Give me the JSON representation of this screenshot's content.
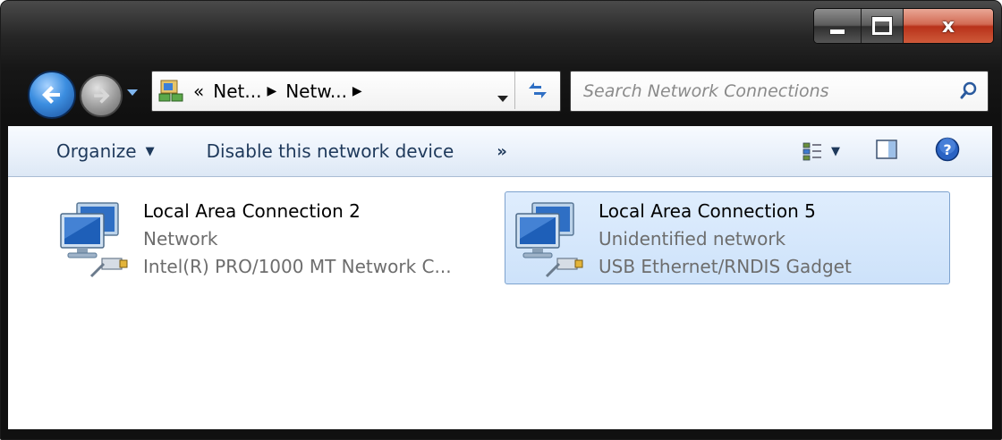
{
  "window": {
    "caption": {
      "close_glyph": "x"
    }
  },
  "navigation": {
    "address_breadcrumbs": [
      "«",
      "Net...",
      "Netw..."
    ],
    "search_placeholder": "Search Network Connections"
  },
  "command_bar": {
    "organize_label": "Organize",
    "disable_label": "Disable this network device",
    "more_label": "»"
  },
  "connections": [
    {
      "name": "Local Area Connection 2",
      "status": "Network",
      "adapter": "Intel(R) PRO/1000 MT Network C...",
      "selected": false
    },
    {
      "name": "Local Area Connection 5",
      "status": "Unidentified network",
      "adapter": "USB Ethernet/RNDIS Gadget",
      "selected": true
    }
  ],
  "colors": {
    "selection_fill": "#cde2fa",
    "selection_border": "#7da2ce",
    "command_text": "#1e395b",
    "close_red": "#c13b20"
  },
  "icons": {
    "back": "back-arrow-icon",
    "forward": "forward-arrow-icon",
    "address": "network-folder-icon",
    "refresh": "refresh-icon",
    "search": "search-icon",
    "views": "change-view-icon",
    "preview_pane": "preview-pane-icon",
    "help": "help-icon",
    "connection": "network-connection-icon"
  }
}
